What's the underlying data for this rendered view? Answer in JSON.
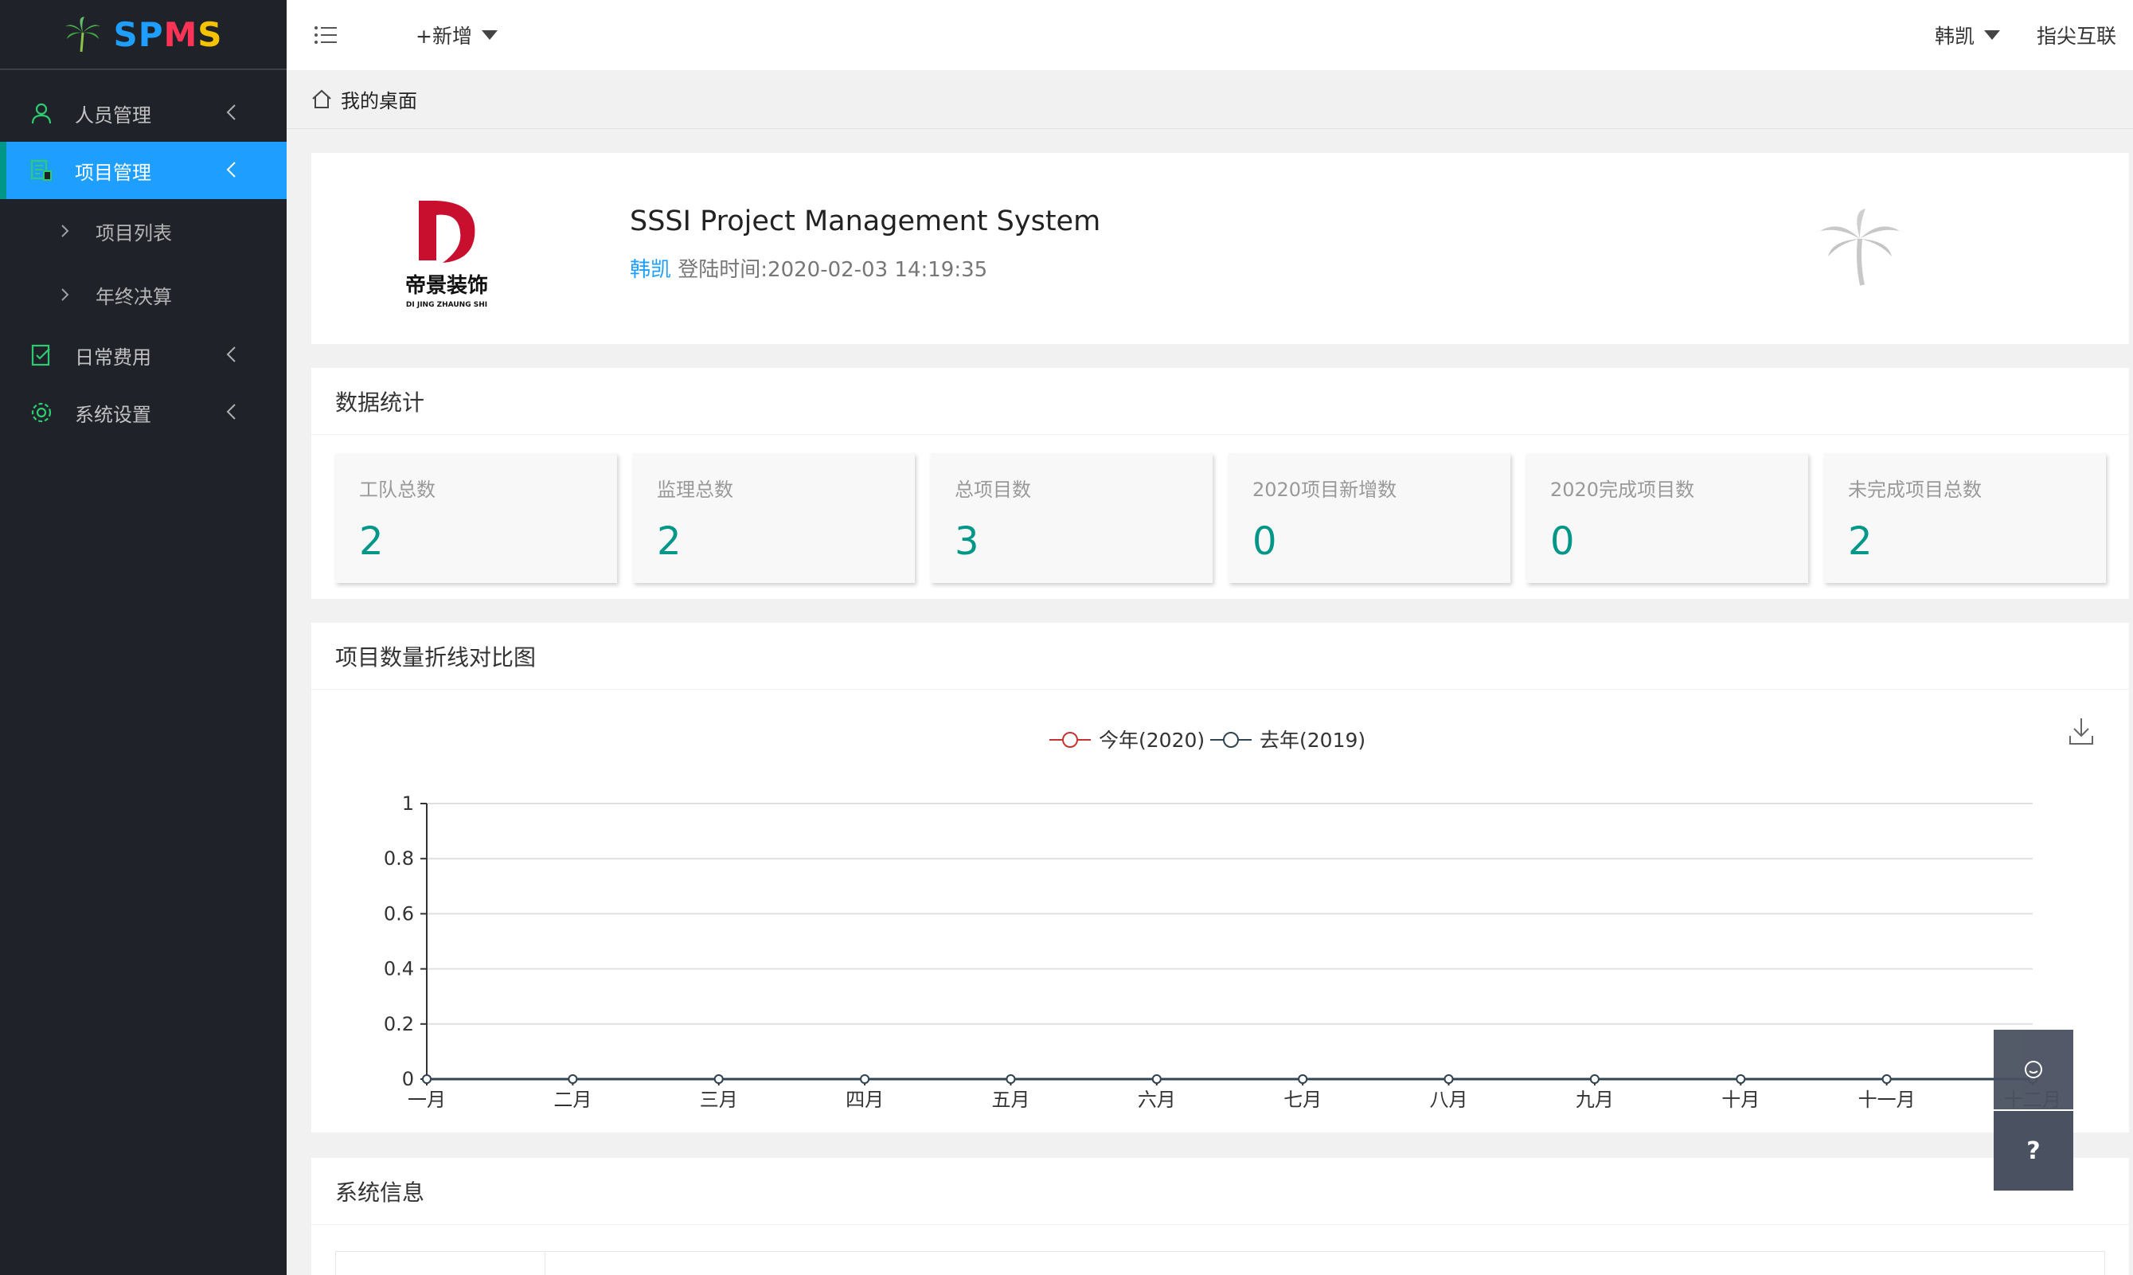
{
  "brand": {
    "name": "SPMS",
    "letters": [
      {
        "ch": "S",
        "color": "#1e9fff"
      },
      {
        "ch": "P",
        "color": "#1e9fff"
      },
      {
        "ch": "M",
        "color": "#ff3355"
      },
      {
        "ch": "S",
        "color": "#f5c200"
      }
    ]
  },
  "sidebar": {
    "items": [
      {
        "label": "人员管理",
        "icon": "user-icon"
      },
      {
        "label": "项目管理",
        "icon": "project-icon",
        "active": true
      },
      {
        "label": "日常费用",
        "icon": "expense-icon"
      },
      {
        "label": "系统设置",
        "icon": "gear-icon"
      }
    ],
    "sub_items": [
      {
        "label": "项目列表"
      },
      {
        "label": "年终决算"
      }
    ]
  },
  "header": {
    "add_label": "+新增",
    "user_name": "韩凯",
    "company": "指尖互联"
  },
  "breadcrumb": {
    "label": "我的桌面"
  },
  "welcome": {
    "title": "SSSI Project Management System",
    "user": "韩凯",
    "login_text": "登陆时间:2020-02-03 14:19:35",
    "logo_cn": "帝景装饰",
    "logo_en": "DI JING ZHAUNG SHI"
  },
  "stats": {
    "title": "数据统计",
    "cards": [
      {
        "label": "工队总数",
        "value": "2"
      },
      {
        "label": "监理总数",
        "value": "2"
      },
      {
        "label": "总项目数",
        "value": "3"
      },
      {
        "label": "2020项目新增数",
        "value": "0"
      },
      {
        "label": "2020完成项目数",
        "value": "0"
      },
      {
        "label": "未完成项目总数",
        "value": "2"
      }
    ]
  },
  "chart_card": {
    "title": "项目数量折线对比图"
  },
  "chart_data": {
    "type": "line",
    "categories": [
      "一月",
      "二月",
      "三月",
      "四月",
      "五月",
      "六月",
      "七月",
      "八月",
      "九月",
      "十月",
      "十一月",
      "十二月"
    ],
    "series": [
      {
        "name": "今年(2020)",
        "color": "#c23531",
        "values": [
          0,
          0,
          0,
          0,
          0,
          0,
          0,
          0,
          0,
          0,
          0,
          0
        ]
      },
      {
        "name": "去年(2019)",
        "color": "#2f4554",
        "values": [
          0,
          0,
          0,
          0,
          0,
          0,
          0,
          0,
          0,
          0,
          0,
          0
        ]
      }
    ],
    "ylim": [
      0,
      1
    ],
    "yticks": [
      "0",
      "0.2",
      "0.4",
      "0.6",
      "0.8",
      "1"
    ],
    "grid": true,
    "legend": "top-center"
  },
  "sysinfo": {
    "title": "系统信息"
  },
  "float": {
    "help_label": "?"
  },
  "colors": {
    "accent": "#1e9fff",
    "teal": "#009688",
    "sidebar_bg": "#20222a"
  }
}
